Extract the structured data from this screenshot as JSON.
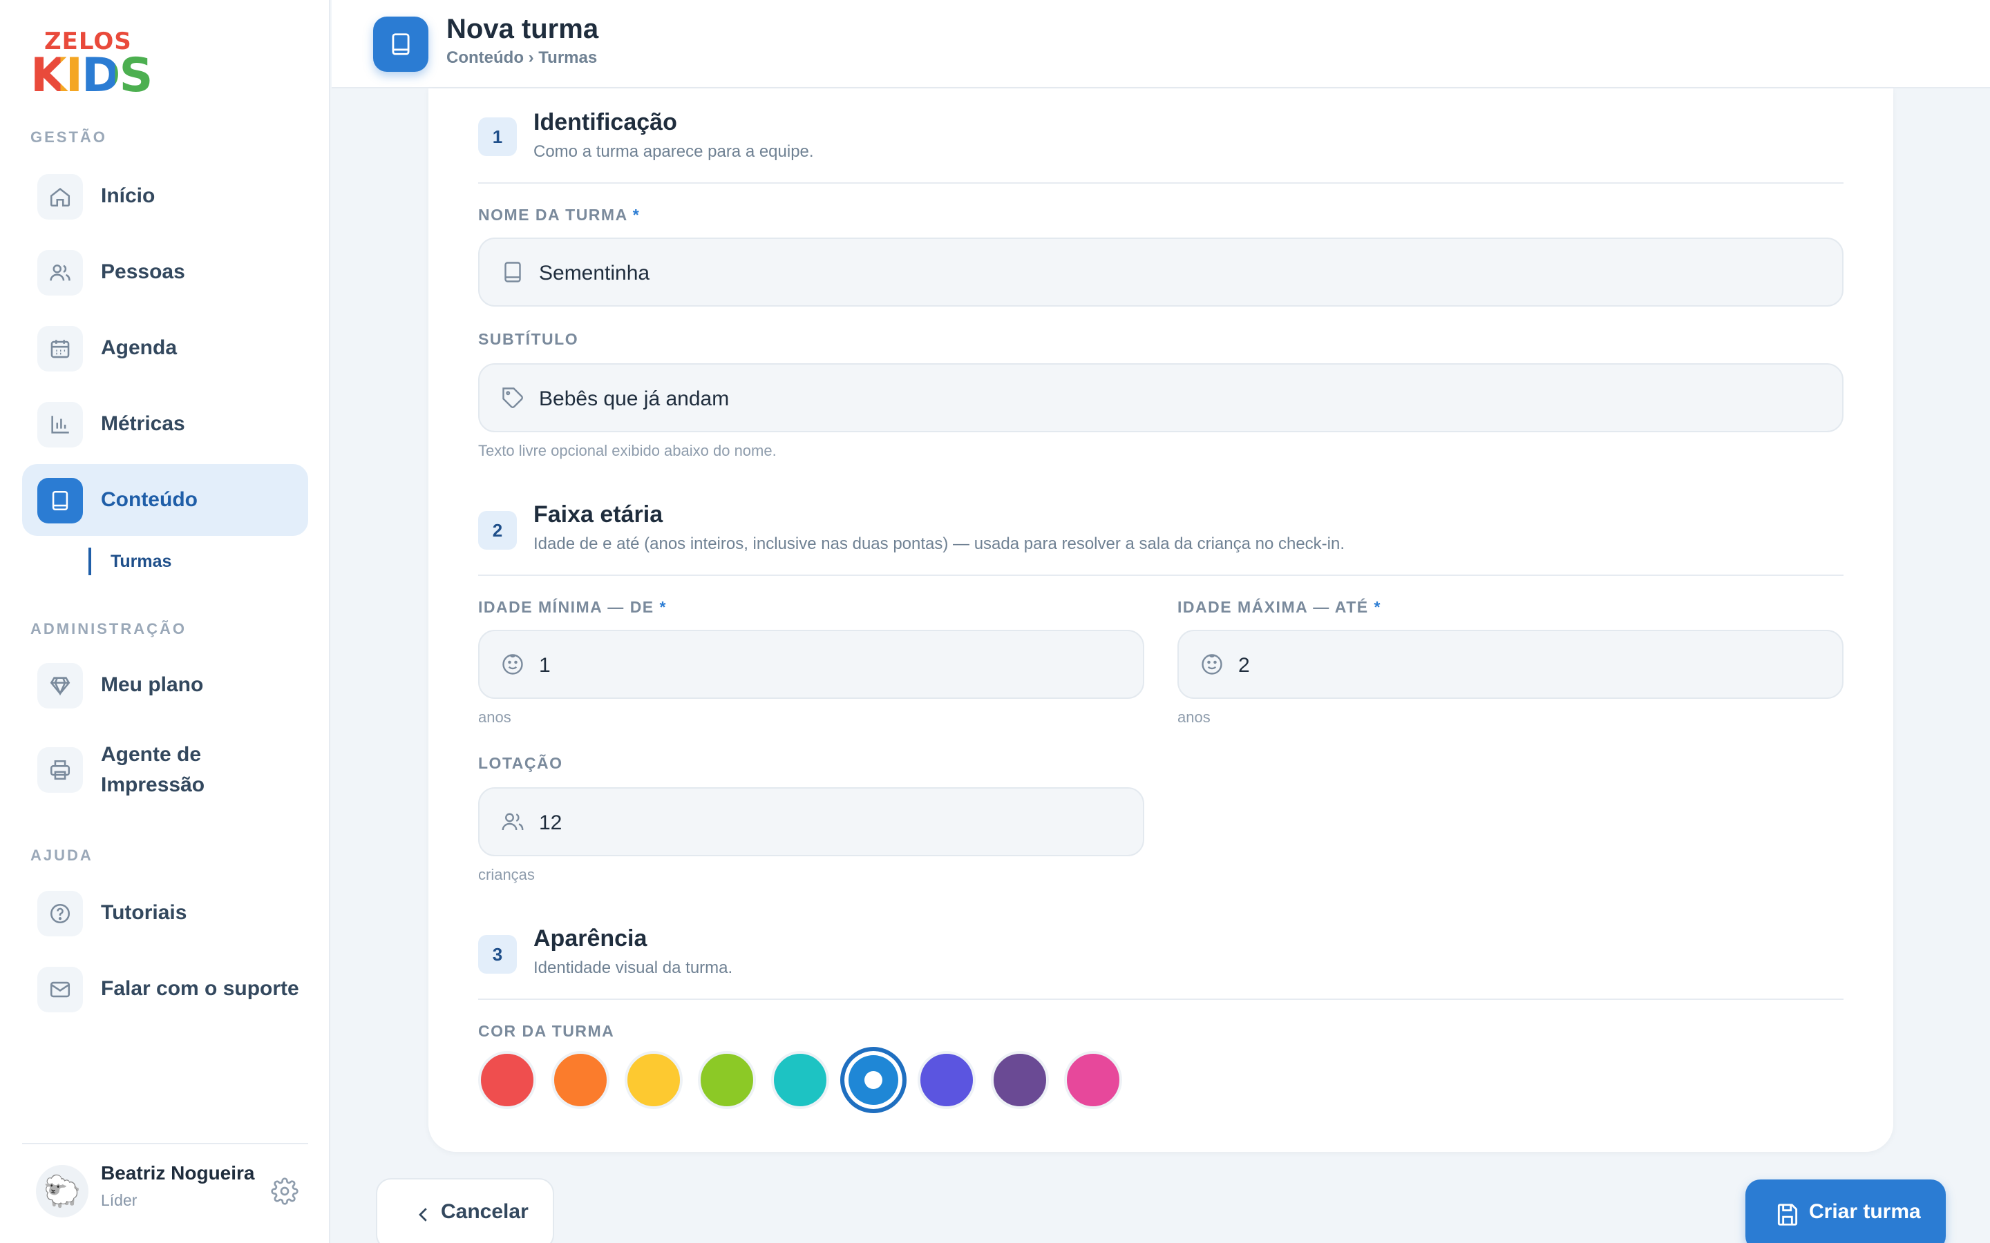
{
  "brand": {
    "logo_line1": "ZELOS",
    "logo_line2": "KIDS"
  },
  "sidebar": {
    "sections": [
      {
        "label": "GESTÃO"
      },
      {
        "label": "ADMINISTRAÇÃO"
      },
      {
        "label": "AJUDA"
      }
    ],
    "items": [
      {
        "label": "Início",
        "icon": "home-icon"
      },
      {
        "label": "Pessoas",
        "icon": "users-icon"
      },
      {
        "label": "Agenda",
        "icon": "calendar-icon"
      },
      {
        "label": "Métricas",
        "icon": "bar-chart-icon"
      },
      {
        "label": "Conteúdo",
        "icon": "book-icon",
        "active": true
      },
      {
        "label": "Meu plano",
        "icon": "diamond-icon"
      },
      {
        "label": "Agente de Impressão",
        "icon": "printer-icon"
      },
      {
        "label": "Tutoriais",
        "icon": "help-circle-icon"
      },
      {
        "label": "Falar com o suporte",
        "icon": "mail-icon"
      }
    ],
    "sub_item": "Turmas",
    "user": {
      "name": "Beatriz Nogueira",
      "role": "Líder",
      "avatar": "sheep-avatar"
    }
  },
  "header": {
    "title": "Nova turma",
    "breadcrumb": "Conteúdo › Turmas",
    "icon": "book-icon"
  },
  "form": {
    "step1": {
      "number": "1",
      "title": "Identificação",
      "desc": "Como a turma aparece para a equipe."
    },
    "name": {
      "label": "NOME DA TURMA",
      "required": "*",
      "value": "Sementinha",
      "icon": "book-icon"
    },
    "subtitle": {
      "label": "SUBTÍTULO",
      "value": "Bebês que já andam",
      "icon": "tag-icon",
      "hint": "Texto livre opcional exibido abaixo do nome."
    },
    "step2": {
      "number": "2",
      "title": "Faixa etária",
      "desc": "Idade de e até (anos inteiros, inclusive nas duas pontas) — usada para resolver a sala da criança no check-in."
    },
    "min_age": {
      "label": "IDADE MÍNIMA — DE",
      "required": "*",
      "value": "1",
      "hint": "anos",
      "icon": "smile-icon"
    },
    "max_age": {
      "label": "IDADE MÁXIMA — ATÉ",
      "required": "*",
      "value": "2",
      "hint": "anos",
      "icon": "smile-icon"
    },
    "capacity": {
      "label": "LOTAÇÃO",
      "value": "12",
      "hint": "crianças",
      "icon": "users-icon"
    },
    "step3": {
      "number": "3",
      "title": "Aparência",
      "desc": "Identidade visual da turma."
    },
    "color": {
      "label": "COR DA TURMA",
      "options": [
        "#ef4e4e",
        "#fb7c2c",
        "#fdc930",
        "#8cc926",
        "#1dc3c3",
        "#1f87d6",
        "#5b55e0",
        "#6a4a94",
        "#e7489b"
      ],
      "selected_index": 5
    }
  },
  "actions": {
    "cancel": "Cancelar",
    "create": "Criar turma"
  }
}
